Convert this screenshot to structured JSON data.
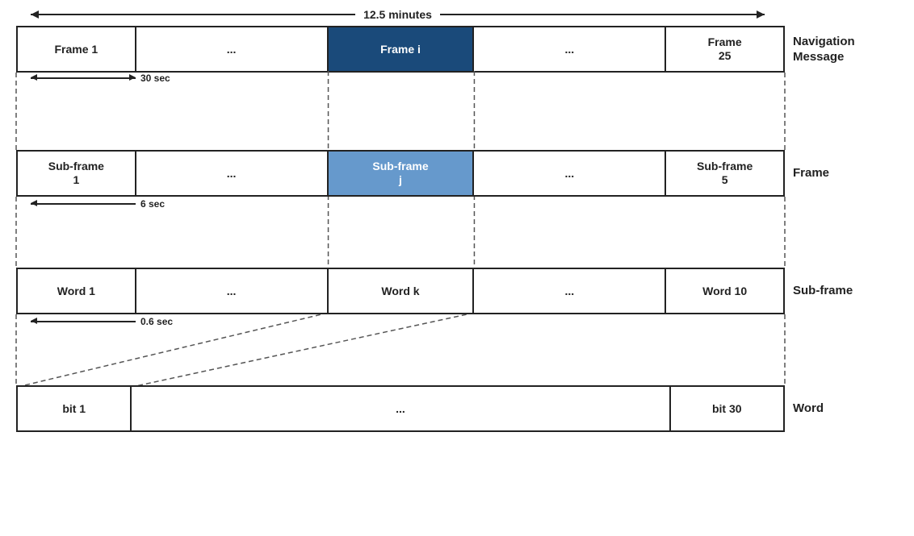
{
  "topArrow": {
    "label": "12.5 minutes"
  },
  "rows": [
    {
      "id": "navigation",
      "label": "Navigation\nMessage",
      "duration": "30 sec",
      "cells": [
        {
          "text": "Frame 1",
          "type": "normal"
        },
        {
          "text": "...",
          "type": "normal"
        },
        {
          "text": "Frame i",
          "type": "dark"
        },
        {
          "text": "...",
          "type": "normal"
        },
        {
          "text": "Frame\n25",
          "type": "normal"
        }
      ]
    },
    {
      "id": "frame",
      "label": "Frame",
      "duration": "6 sec",
      "cells": [
        {
          "text": "Sub-frame\n1",
          "type": "normal"
        },
        {
          "text": "...",
          "type": "normal"
        },
        {
          "text": "Sub-frame\nj",
          "type": "light"
        },
        {
          "text": "...",
          "type": "normal"
        },
        {
          "text": "Sub-frame\n5",
          "type": "normal"
        }
      ]
    },
    {
      "id": "subframe",
      "label": "Sub-frame",
      "duration": "0.6 sec",
      "cells": [
        {
          "text": "Word 1",
          "type": "normal"
        },
        {
          "text": "...",
          "type": "normal"
        },
        {
          "text": "Word k",
          "type": "normal"
        },
        {
          "text": "...",
          "type": "normal"
        },
        {
          "text": "Word 10",
          "type": "normal"
        }
      ]
    },
    {
      "id": "word",
      "label": "Word",
      "duration": null,
      "cells": [
        {
          "text": "bit 1",
          "type": "normal"
        },
        {
          "text": "...",
          "type": "normal"
        },
        {
          "text": "bit 30",
          "type": "normal"
        }
      ]
    }
  ]
}
